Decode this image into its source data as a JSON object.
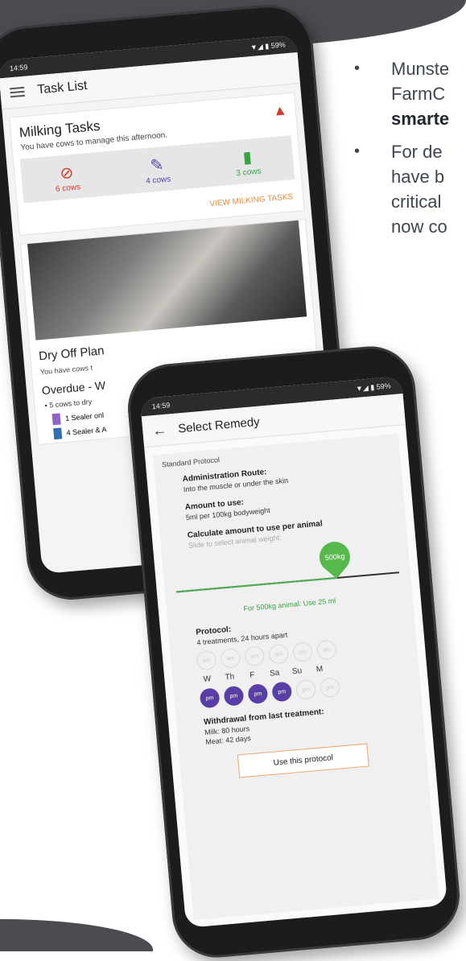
{
  "bullets": [
    {
      "lines": [
        "Munste",
        "FarmC"
      ],
      "bold": "smarte"
    },
    {
      "lines": [
        "For de",
        "have b",
        "critical",
        "now co"
      ],
      "bold": ""
    }
  ],
  "phone1": {
    "status_time": "14:59",
    "status_right": "▼◢ ▮ 59%",
    "title": "Task List",
    "milking": {
      "title": "Milking Tasks",
      "subtitle": "You have cows to manage this afternoon.",
      "items": [
        {
          "label": "6 cows",
          "color": "#d63a2f"
        },
        {
          "label": "4 cows",
          "color": "#5a3ea8"
        },
        {
          "label": "3 cows",
          "color": "#3aa044"
        }
      ],
      "link": "VIEW MILKING TASKS"
    },
    "dry": {
      "title": "Dry Off Plan",
      "subtitle": "You have cows t",
      "overdue": "Overdue - W",
      "item": "• 5 cows to dry",
      "tags": [
        {
          "label": "1 Sealer onl",
          "color": "#8e64c8"
        },
        {
          "label": "4 Sealer & A",
          "color": "#2f6fb3"
        }
      ]
    }
  },
  "phone2": {
    "status_time": "14:59",
    "status_right": "▼◢ ▮ 59%",
    "title": "Select Remedy",
    "protocol_header": "Standard Protocol",
    "route_label": "Administration Route:",
    "route_value": "Into the muscle or under the skin",
    "amount_label": "Amount to use:",
    "amount_value": "5ml per 100kg bodyweight",
    "calc_label": "Calculate amount to use per animal",
    "calc_hint": "Slide to select animal weight:",
    "slider": {
      "value_label": "500kg",
      "fraction": 0.72
    },
    "result": "For 500kg animal: Use 25 ml",
    "protocol_label": "Protocol:",
    "protocol_value": "4 treatments, 24 hours apart",
    "row1": [
      "am",
      "am",
      "am",
      "am",
      "pm",
      "am"
    ],
    "days": [
      "W",
      "Th",
      "F",
      "Sa",
      "Su",
      "M"
    ],
    "row2": [
      {
        "t": "pm",
        "on": true
      },
      {
        "t": "pm",
        "on": true
      },
      {
        "t": "pm",
        "on": true
      },
      {
        "t": "pm",
        "on": true
      },
      {
        "t": "pm",
        "on": false
      },
      {
        "t": "pm",
        "on": false
      }
    ],
    "withdrawal_label": "Withdrawal from last treatment:",
    "milk": "Milk: 80 hours",
    "meat": "Meat: 42 days",
    "button": "Use this protocol"
  }
}
